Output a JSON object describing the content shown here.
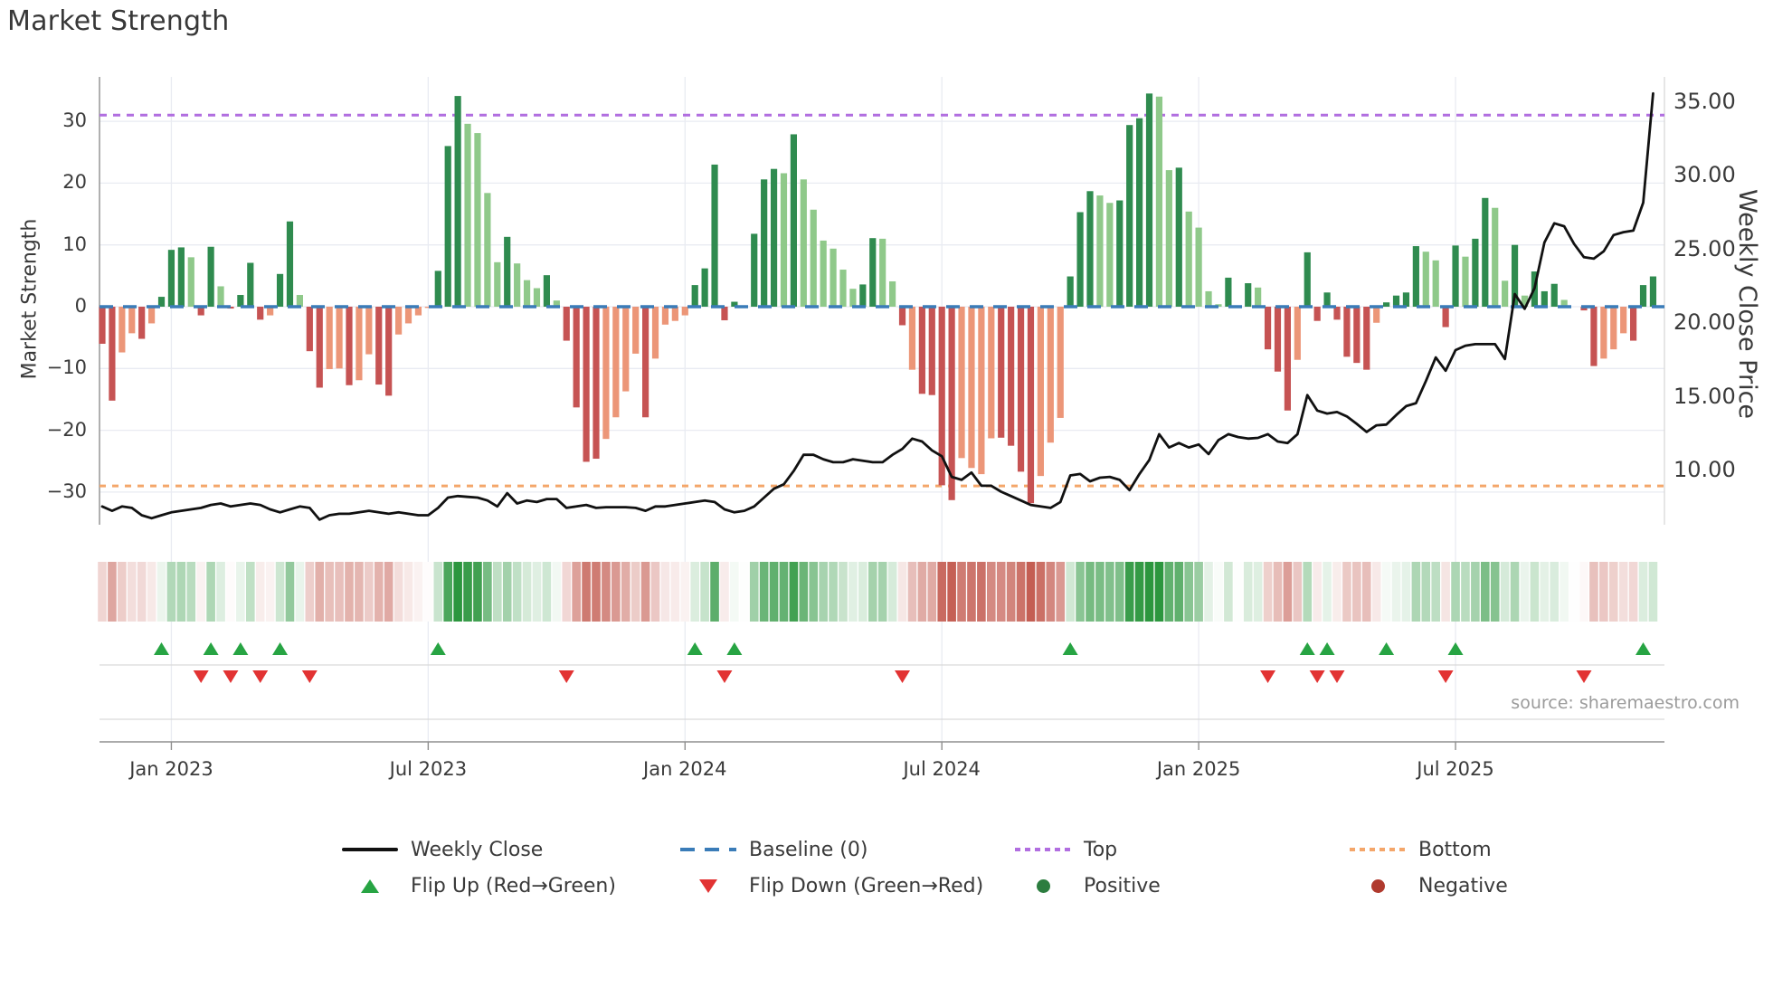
{
  "title": "Market Strength",
  "source": "source: sharemaestro.com",
  "axes": {
    "left": {
      "label": "Market Strength",
      "tick_values": [
        30,
        20,
        10,
        0,
        -10,
        -20,
        -30
      ],
      "tick_labels": [
        "30",
        "20",
        "10",
        "0",
        "−10",
        "−20",
        "−30"
      ]
    },
    "right": {
      "label": "Weekly Close Price",
      "tick_values": [
        35,
        30,
        25,
        20,
        15,
        10
      ],
      "tick_labels": [
        "35.00",
        "30.00",
        "25.00",
        "20.00",
        "15.00",
        "10.00"
      ]
    },
    "x": {
      "tick_labels": [
        "Jan 2023",
        "Jul 2023",
        "Jan 2024",
        "Jul 2024",
        "Jan 2025",
        "Jul 2025"
      ],
      "tick_week_index": [
        7,
        33,
        59,
        85,
        111,
        137
      ]
    }
  },
  "reference_lines": {
    "baseline": {
      "label": "Baseline (0)",
      "value": 0,
      "color": "#3a7cb8"
    },
    "top": {
      "label": "Top",
      "value": 31,
      "color": "#b16ee0"
    },
    "bottom": {
      "label": "Bottom",
      "value": -29,
      "color": "#f4a66a"
    }
  },
  "colors": {
    "bar_pos_dark": "#2f8b4f",
    "bar_pos_light": "#8fc98a",
    "bar_neg_dark": "#c65353",
    "bar_neg_light": "#ec9678",
    "price_line": "#111111",
    "flip_up": "#27a443",
    "flip_down": "#e23333",
    "heat_pos": "#2c9640",
    "heat_neg": "#c45d52",
    "grid": "#e9ebf2",
    "spine": "#9a9a9a",
    "band_line": "#d9d9d9",
    "text": "#3a3a3a"
  },
  "legend": {
    "items": [
      {
        "id": "weekly-close",
        "label": "Weekly Close",
        "glyph": "line-solid",
        "color": "#111111"
      },
      {
        "id": "baseline",
        "label": "Baseline (0)",
        "glyph": "line-dashed",
        "color": "#3a7cb8"
      },
      {
        "id": "top",
        "label": "Top",
        "glyph": "line-dotted",
        "color": "#b16ee0"
      },
      {
        "id": "bottom",
        "label": "Bottom",
        "glyph": "line-dotted",
        "color": "#f4a66a"
      },
      {
        "id": "flip-up",
        "label": "Flip Up (Red→Green)",
        "glyph": "triangle-up",
        "color": "#27a443"
      },
      {
        "id": "flip-down",
        "label": "Flip Down (Green→Red)",
        "glyph": "triangle-down",
        "color": "#e23333"
      },
      {
        "id": "positive",
        "label": "Positive",
        "glyph": "dot",
        "color": "#2c7d3f"
      },
      {
        "id": "negative",
        "label": "Negative",
        "glyph": "dot",
        "color": "#b03a2e"
      }
    ]
  },
  "chart_data": {
    "type": "combo",
    "description": "Weekly market-strength bars (left axis), weekly close price line (right axis), strength heatmap strip and flip markers. 158 weekly points, Nov 2022 - Nov 2025.",
    "x_unit": "week",
    "n_weeks": 158,
    "strength_bars": {
      "type": "bar",
      "ylim": [
        -36,
        37
      ],
      "values": [
        -6.0,
        -15.2,
        -7.4,
        -4.3,
        -5.2,
        -2.7,
        1.6,
        9.2,
        9.6,
        8.0,
        -1.4,
        9.7,
        3.3,
        -0.3,
        1.9,
        7.1,
        -2.1,
        -1.4,
        5.3,
        13.8,
        1.9,
        -7.2,
        -13.1,
        -10.1,
        -10.0,
        -12.7,
        -11.9,
        -7.7,
        -12.6,
        -14.4,
        -4.5,
        -2.7,
        -1.4,
        -0.2,
        5.8,
        26.0,
        34.1,
        29.6,
        28.1,
        18.4,
        7.2,
        11.3,
        7.0,
        4.3,
        3.0,
        5.1,
        1.0,
        -5.5,
        -16.3,
        -25.1,
        -24.6,
        -21.4,
        -17.9,
        -13.7,
        -7.6,
        -17.9,
        -8.4,
        -2.9,
        -2.3,
        -1.4,
        3.5,
        6.2,
        23.0,
        -2.2,
        0.8,
        0.1,
        11.8,
        20.6,
        22.3,
        21.6,
        27.9,
        20.6,
        15.7,
        10.7,
        9.4,
        6.0,
        2.9,
        3.6,
        11.1,
        11.0,
        4.1,
        -3.0,
        -10.2,
        -14.1,
        -14.3,
        -28.9,
        -31.3,
        -24.5,
        -26.1,
        -27.1,
        -21.3,
        -21.2,
        -22.5,
        -26.7,
        -31.8,
        -27.4,
        -22.0,
        -18.0,
        4.9,
        15.3,
        18.7,
        18.0,
        16.8,
        17.2,
        29.4,
        30.5,
        34.5,
        34.0,
        22.1,
        22.5,
        15.4,
        12.8,
        2.5,
        0.4,
        4.7,
        0.1,
        3.8,
        3.1,
        -6.9,
        -10.5,
        -16.8,
        -8.6,
        8.8,
        -2.3,
        2.3,
        -2.1,
        -8.1,
        -9.1,
        -10.2,
        -2.6,
        0.7,
        1.8,
        2.3,
        9.8,
        8.9,
        7.5,
        -3.3,
        9.9,
        8.1,
        11.0,
        17.6,
        16.0,
        4.2,
        10.0,
        1.8,
        5.7,
        2.5,
        3.7,
        1.1,
        0.05,
        -0.6,
        -9.6,
        -8.4,
        -6.9,
        -4.3,
        -5.5,
        3.5,
        4.9
      ],
      "shades": "DDLLDLDDDLDDLDDDDLDDLDDLLDLLDDLLLLDDDLLLLDLLLDLDDDDLLLLDLLLLDDDDDLDDDLDLLLLLLDDLLDLDDDDLLLLDDDDLLLDDDLLDDDDLLDLLLLDLDLDDDLDDDDDDDLDDDDLLDDLDDLLDLDDDLLDDLLLDDD"
    },
    "price_line": {
      "type": "line",
      "name": "Weekly Close",
      "ylim_right": [
        6.3,
        36.6
      ],
      "values": [
        7.5,
        7.2,
        7.5,
        7.4,
        6.9,
        6.7,
        6.9,
        7.1,
        7.2,
        7.3,
        7.4,
        7.6,
        7.7,
        7.5,
        7.6,
        7.7,
        7.6,
        7.3,
        7.1,
        7.3,
        7.5,
        7.4,
        6.6,
        6.9,
        7.0,
        7.0,
        7.1,
        7.2,
        7.1,
        7.0,
        7.1,
        7.0,
        6.9,
        6.9,
        7.4,
        8.1,
        8.2,
        8.15,
        8.1,
        7.9,
        7.5,
        8.4,
        7.7,
        7.9,
        7.8,
        8.0,
        8.0,
        7.4,
        7.5,
        7.6,
        7.4,
        7.45,
        7.45,
        7.45,
        7.4,
        7.2,
        7.5,
        7.5,
        7.6,
        7.7,
        7.8,
        7.9,
        7.8,
        7.3,
        7.1,
        7.2,
        7.5,
        8.1,
        8.7,
        9.0,
        9.9,
        11.0,
        11.0,
        10.7,
        10.5,
        10.5,
        10.7,
        10.6,
        10.5,
        10.5,
        11.0,
        11.4,
        12.1,
        11.9,
        11.3,
        10.9,
        9.5,
        9.3,
        9.8,
        8.9,
        8.9,
        8.5,
        8.2,
        7.9,
        7.6,
        7.5,
        7.4,
        7.8,
        9.6,
        9.7,
        9.2,
        9.45,
        9.5,
        9.3,
        8.6,
        9.7,
        10.65,
        12.4,
        11.5,
        11.8,
        11.5,
        11.7,
        11.05,
        12.0,
        12.4,
        12.2,
        12.1,
        12.15,
        12.4,
        11.9,
        11.8,
        12.4,
        15.05,
        14.0,
        13.8,
        13.9,
        13.6,
        13.1,
        12.55,
        13.0,
        13.05,
        13.7,
        14.3,
        14.5,
        16.0,
        17.6,
        16.7,
        18.1,
        18.4,
        18.5,
        18.5,
        18.5,
        17.5,
        21.9,
        20.9,
        22.3,
        25.4,
        26.7,
        26.5,
        25.3,
        24.4,
        24.3,
        24.8,
        25.9,
        26.1,
        26.2,
        28.1,
        35.5
      ]
    },
    "heatmap": {
      "type": "heatmap",
      "note": "one cell per week, diverging red-white-green colormap of strength values"
    },
    "flip_markers": {
      "rule": "up where strength flips negative to positive; down where it flips positive to negative",
      "up_weeks": [
        6,
        11,
        14,
        18,
        34,
        60,
        64,
        98,
        122,
        124,
        130,
        137,
        156
      ],
      "down_weeks": [
        10,
        13,
        16,
        21,
        47,
        63,
        81,
        118,
        123,
        125,
        136,
        150
      ]
    }
  }
}
